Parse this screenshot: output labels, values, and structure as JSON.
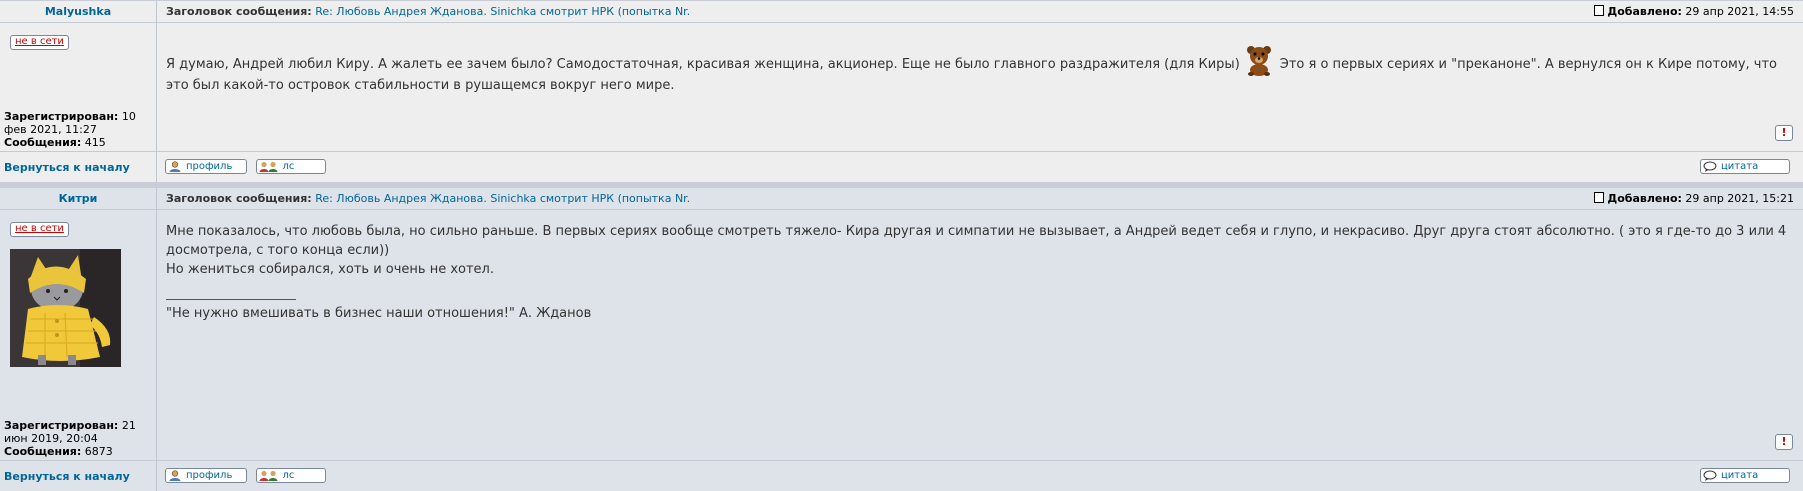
{
  "posts": [
    {
      "author": "Malyushka",
      "status": "не в сети",
      "registered_label": "Зарегистрирован:",
      "registered_value": "10 фев 2021, 11:27",
      "posts_label": "Сообщения:",
      "posts_value": "415",
      "subject_label": "Заголовок сообщения:",
      "subject": "Re: Любовь Андрея Жданова. Sinichka смотрит НРК (попытка Nr.",
      "added_label": "Добавлено:",
      "added_value": "29 апр 2021, 14:55",
      "text_before_smiley": "Я думаю, Андрей любил Киру. А жалеть ее зачем было? Самодостаточная, красивая женщина, акционер. Еще не было главного раздражителя (для Киры)",
      "text_after_smiley": "Это я о первых сериях и \"преканоне\". А вернулся он к Кире потому, что это был какой-то островок стабильности в рушащемся вокруг него мире.",
      "back_to_top": "Вернуться к началу",
      "profile_label": "профиль",
      "pm_label": "лс",
      "quote_label": "цитата"
    },
    {
      "author": "Китри",
      "status": "не в сети",
      "registered_label": "Зарегистрирован:",
      "registered_value": "21 июн 2019, 20:04",
      "posts_label": "Сообщения:",
      "posts_value": "6873",
      "subject_label": "Заголовок сообщения:",
      "subject": "Re: Любовь Андрея Жданова. Sinichka смотрит НРК (попытка Nr.",
      "added_label": "Добавлено:",
      "added_value": "29 апр 2021, 15:21",
      "paragraph1": "Мне показалось, что любовь была, но сильно раньше. В первых сериях вообще смотреть тяжело- Кира другая и симпатии не вызывает, а Андрей ведет себя и глупо, и некрасиво. Друг друга стоят абсолютно. ( это я где-то до 3 или 4 досмотрела, с того конца если))",
      "paragraph2": "Но жениться собирался, хоть и очень не хотел.",
      "signature": "\"Не нужно вмешивать в бизнес наши отношения!\" А. Жданов",
      "back_to_top": "Вернуться к началу",
      "profile_label": "профиль",
      "pm_label": "лс",
      "quote_label": "цитата"
    }
  ],
  "colors": {
    "link": "#006699",
    "offline": "#cc0000",
    "post1_bg": "#eeeeee",
    "post2_bg": "#dee3e9"
  },
  "icons": [
    "post-icon",
    "bear-smiley-icon",
    "report-icon",
    "profile-icon",
    "pm-icon",
    "quote-icon"
  ]
}
